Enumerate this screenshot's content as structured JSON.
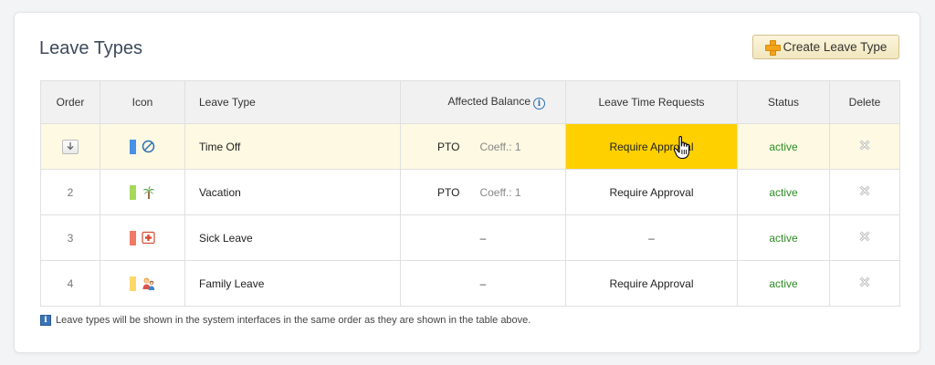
{
  "page": {
    "title": "Leave Types",
    "create_button_label": "Create Leave Type",
    "footer_note": "Leave types will be shown in the system interfaces in the same order as they are shown in the table above."
  },
  "table": {
    "headers": {
      "order": "Order",
      "icon": "Icon",
      "leave_type": "Leave Type",
      "affected_balance": "Affected Balance",
      "leave_time_requests": "Leave Time Requests",
      "status": "Status",
      "delete": "Delete"
    },
    "rows": [
      {
        "order": "",
        "order_control": "move-down",
        "color": "#4a8fe8",
        "icon": "no-entry-icon",
        "name": "Time Off",
        "balance": "PTO",
        "coef": "Coeff.: 1",
        "requests": "Require Approval",
        "status": "active"
      },
      {
        "order": "2",
        "color": "#a6d85a",
        "icon": "palm-tree-icon",
        "name": "Vacation",
        "balance": "PTO",
        "coef": "Coeff.: 1",
        "requests": "Require Approval",
        "status": "active"
      },
      {
        "order": "3",
        "color": "#f07a66",
        "icon": "first-aid-icon",
        "name": "Sick Leave",
        "balance": "–",
        "coef": "",
        "requests": "–",
        "status": "active"
      },
      {
        "order": "4",
        "color": "#fcd86a",
        "icon": "family-icon",
        "name": "Family Leave",
        "balance": "–",
        "coef": "",
        "requests": "Require Approval",
        "status": "active"
      }
    ]
  },
  "colors": {
    "highlight_row": "#fdf9e2",
    "active_cell": "#fed000",
    "status_active": "#2c8c23"
  }
}
